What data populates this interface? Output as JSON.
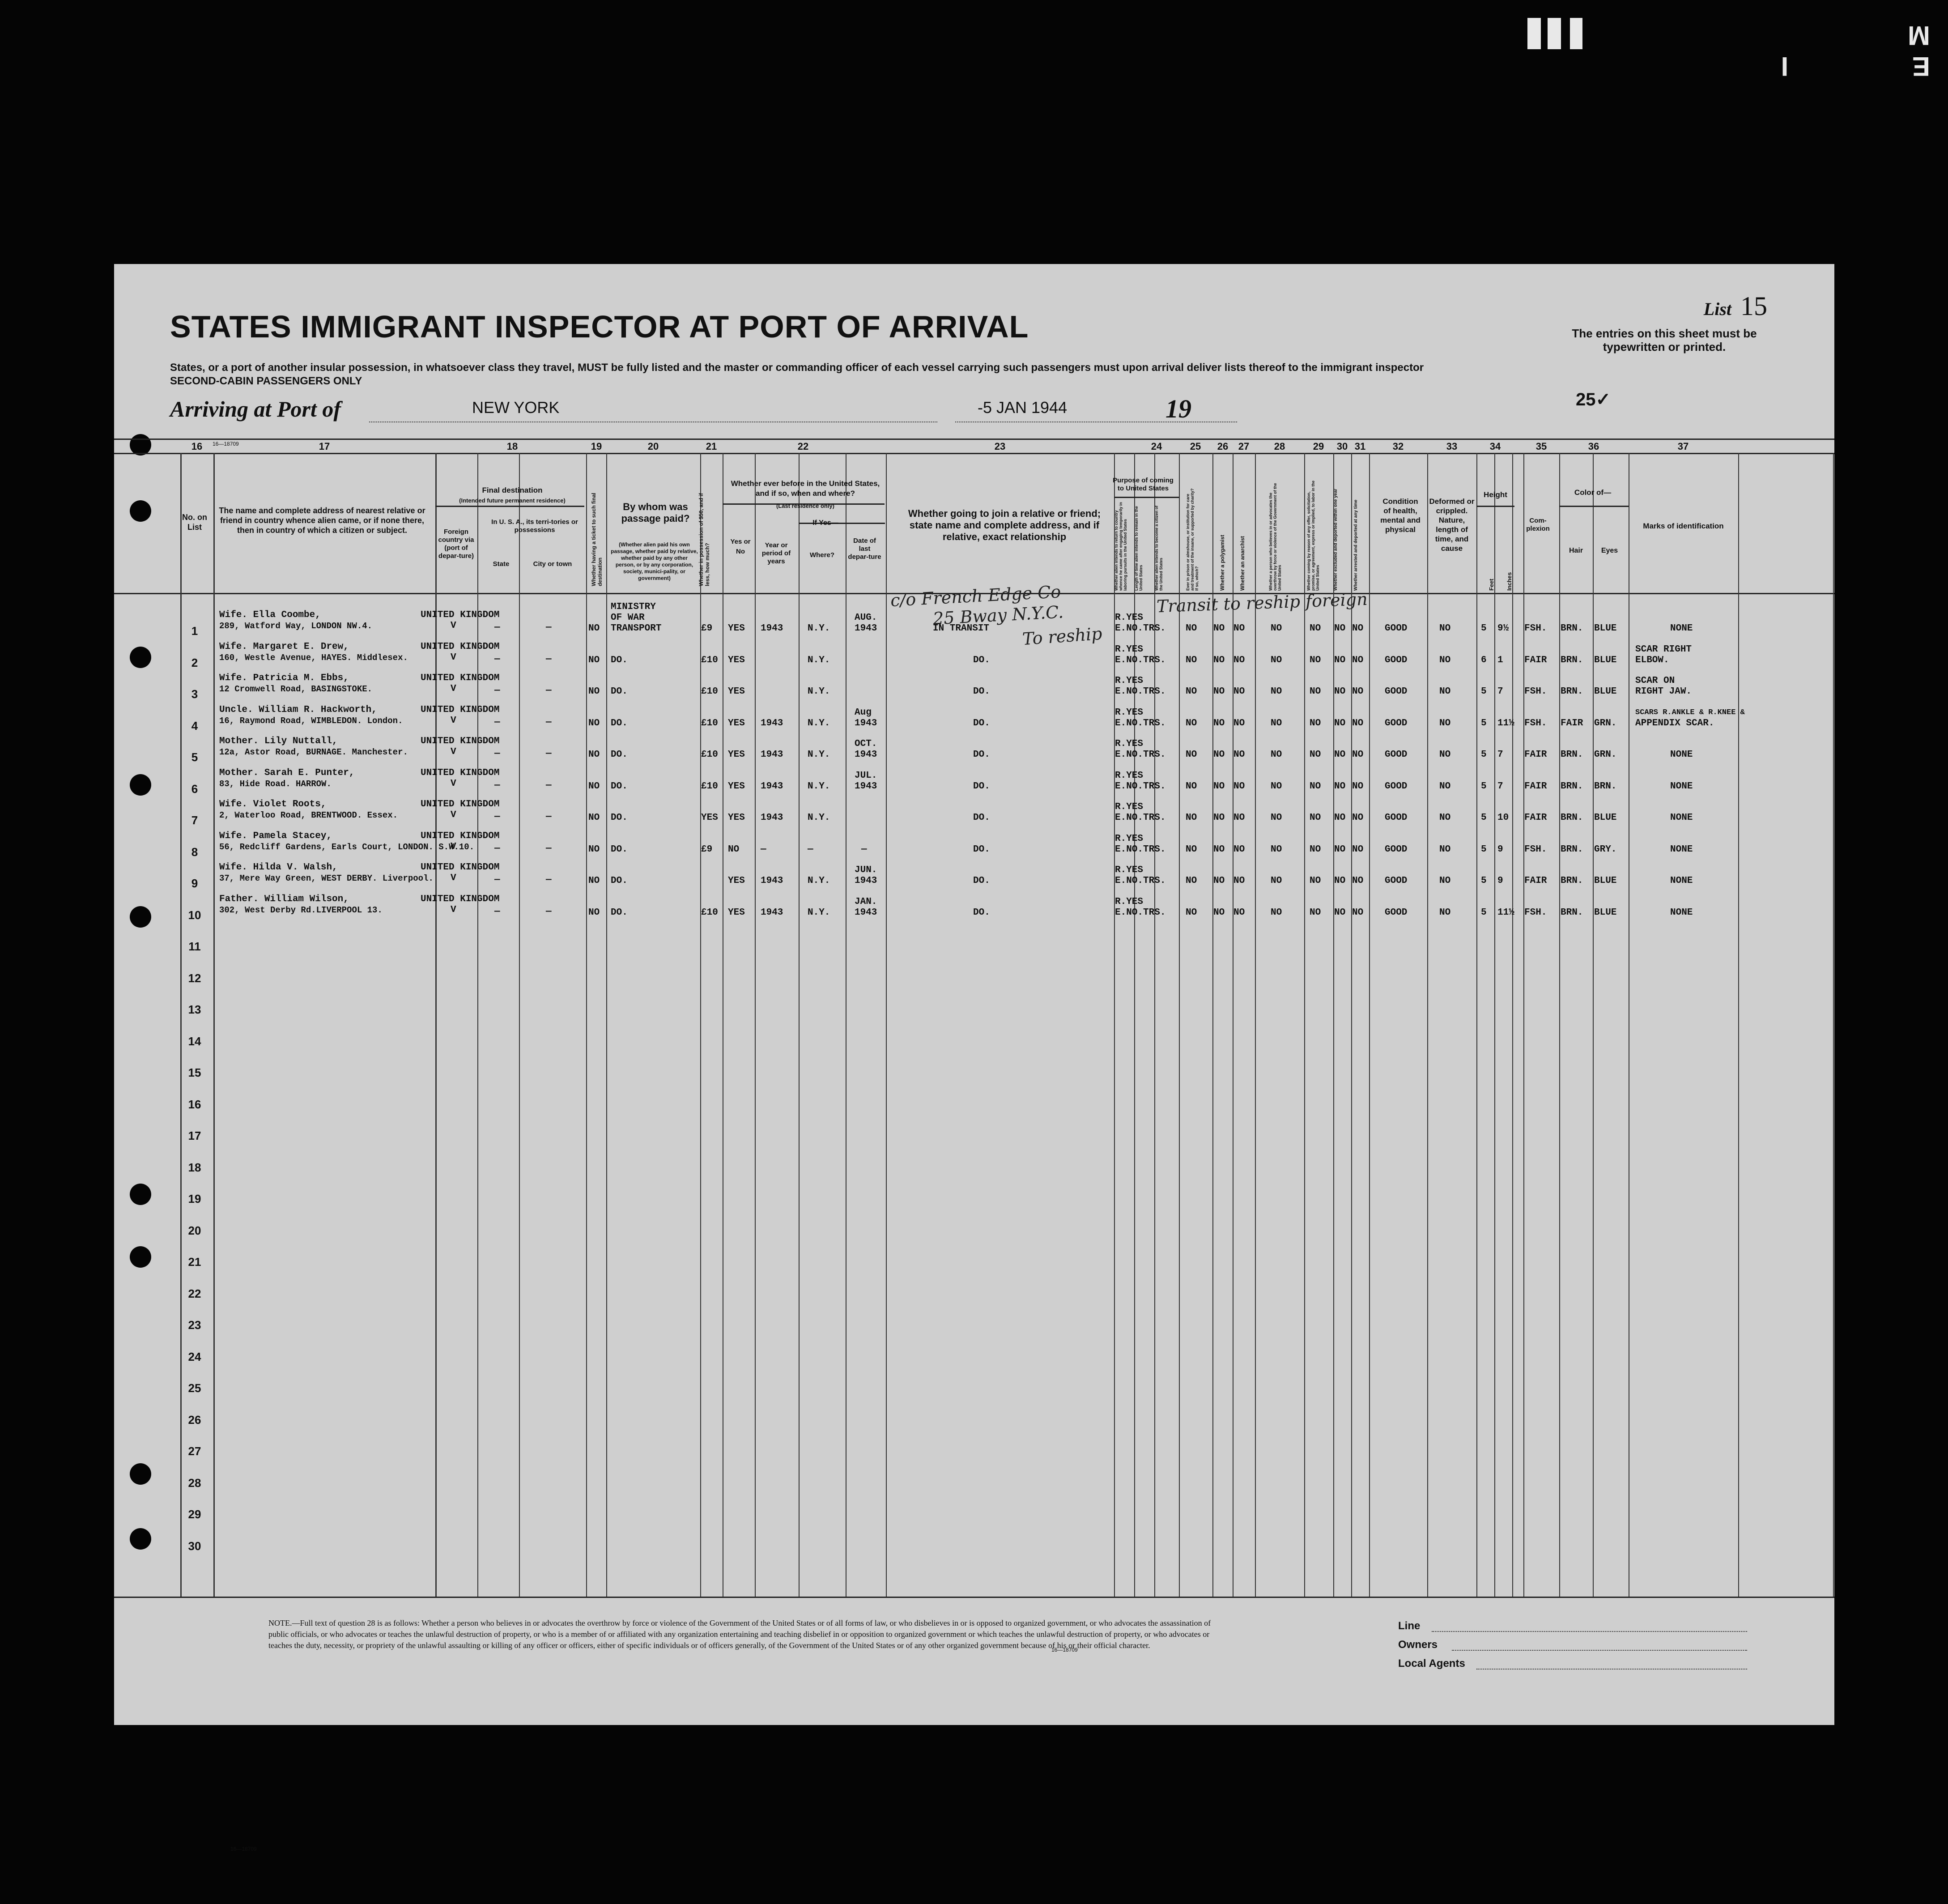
{
  "header": {
    "title": "STATES IMMIGRANT INSPECTOR AT PORT OF ARRIVAL",
    "subtitle": "States, or a port of another insular possession, in whatsoever class they travel, MUST be fully listed and the master or commanding officer of each vessel carrying such passengers must upon arrival deliver lists thereof to the immigrant inspector",
    "subtitle2": "SECOND-CABIN PASSENGERS ONLY",
    "list_label": "List",
    "list_number": "15",
    "entries_note": "The entries on this sheet must be typewritten or printed.",
    "arriving_label": "Arriving at Port of",
    "port": "NEW YORK",
    "date": "-5 JAN 1944",
    "year_label": "19",
    "count": "25✓",
    "film_mark": "E I M"
  },
  "columns": {
    "numbers": [
      "16",
      "17",
      "18",
      "19",
      "20",
      "21",
      "22",
      "23",
      "24",
      "25",
      "26",
      "27",
      "28",
      "29",
      "30",
      "31",
      "32",
      "33",
      "34",
      "35",
      "36",
      "37"
    ],
    "no_on_list": "No. on List",
    "c17": "The name and complete address of nearest relative or friend in country whence alien came, or if none there, then in country of which a citizen or subject.",
    "c18": "Final destination",
    "c18_note": "(Intended future permanent residence)",
    "c18a": "Foreign country via (port of depar-ture)",
    "c18b": "In U. S. A., its terri-tories or possessions",
    "c18_state": "State",
    "c18_city": "City or town",
    "c19": "Whether having a ticket to such final destination",
    "c20": "By whom was passage paid?",
    "c20_note": "(Whether alien paid his own passage, whether paid by relative, whether paid by any other person, or by any corporation, society, munici-pality, or government)",
    "c21": "Whether in possession of $50, and if less, how much?",
    "c22": "Whether ever before in the United States, and if so, when and where?",
    "c22_note": "(Last residence only)",
    "c22_if": "If Yes—",
    "c22_yes": "Yes or No",
    "c22_year": "Year or period of years",
    "c22_where": "Where?",
    "c22_date": "Date of last depar-ture",
    "c23": "Whether going to join a relative or friend; state name and complete address, and if relative, exact relationship",
    "c24": "Purpose of coming to United States",
    "c24a": "Whether alien intends to return to country whence he came after engaging temporarily in laboring pursuits in the United States",
    "c24b": "Length of time alien intends to remain in the United States",
    "c24c": "Whether alien intends to become a citizen of the United States",
    "c25": "Ever in prison or almshouse, or institution for care and treatment of the insane, or supported by charity? If so, which?",
    "c26": "Whether a polygamist",
    "c27": "Whether an anarchist",
    "c28": "Whether a person who believes in or advocates the overthrow by force or violence of the Government of the United States",
    "c29": "Whether coming by reason of any offer, solicitation, promise, or agreement, express or implied, to labor in the United States",
    "c30": "Whether excluded and deported within one year",
    "c31": "Whether arrested and deported at any time",
    "c32": "Condition of health, mental and physical",
    "c33": "Deformed or crippled. Nature, length of time, and cause",
    "c34": "Height",
    "c34_feet": "Feet",
    "c34_inches": "Inches",
    "c35": "Com-plexion",
    "c36": "Color of—",
    "c36_hair": "Hair",
    "c36_eyes": "Eyes",
    "c37": "Marks of identification"
  },
  "rows": [
    {
      "no": "1",
      "rel1": "Wife. Ella Coombe,",
      "rel2": "289, Watford Way, LONDON NW.4.",
      "country": "UNITED KINGDOM",
      "via": "V",
      "state": "—",
      "city": "—",
      "ticket": "NO",
      "paid1": "MINISTRY",
      "paid2": "OF WAR",
      "paid3": "TRANSPORT",
      "money": "£9",
      "yes": "YES",
      "period": "1943",
      "where": "N.Y.",
      "dep1": "AUG.",
      "dep2": "1943",
      "join": "IN TRANSIT",
      "p1": "R.YES",
      "p2": "E.NO.TRS.",
      "c25": "NO",
      "c26": "NO",
      "c27": "NO",
      "c28": "NO",
      "c29": "NO",
      "c30": "NO",
      "c31": "NO",
      "health": "GOOD",
      "deformed": "NO",
      "feet": "5",
      "inches": "9½",
      "complexion": "FSH.",
      "hair": "BRN.",
      "eyes": "BLUE",
      "marks1": "NONE",
      "marks2": ""
    },
    {
      "no": "2",
      "rel1": "Wife. Margaret E. Drew,",
      "rel2": "160, Westle Avenue, HAYES. Middlesex.",
      "country": "UNITED KINGDOM",
      "via": "V",
      "state": "—",
      "city": "—",
      "ticket": "NO",
      "paid1": "DO.",
      "paid2": "",
      "paid3": "",
      "money": "£10",
      "yes": "YES",
      "period": "",
      "where": "N.Y.",
      "dep1": "",
      "dep2": "",
      "join": "DO.",
      "p1": "R.YES",
      "p2": "E.NO.TRS.",
      "c25": "NO",
      "c26": "NO",
      "c27": "NO",
      "c28": "NO",
      "c29": "NO",
      "c30": "NO",
      "c31": "NO",
      "health": "GOOD",
      "deformed": "NO",
      "feet": "6",
      "inches": "1",
      "complexion": "FAIR",
      "hair": "BRN.",
      "eyes": "BLUE",
      "marks1": "SCAR RIGHT",
      "marks2": "ELBOW."
    },
    {
      "no": "3",
      "rel1": "Wife. Patricia M. Ebbs,",
      "rel2": "12 Cromwell Road, BASINGSTOKE.",
      "country": "UNITED KINGDOM",
      "via": "V",
      "state": "—",
      "city": "—",
      "ticket": "NO",
      "paid1": "DO.",
      "paid2": "",
      "paid3": "",
      "money": "£10",
      "yes": "YES",
      "period": "",
      "where": "N.Y.",
      "dep1": "",
      "dep2": "",
      "join": "DO.",
      "p1": "R.YES",
      "p2": "E.NO.TRS.",
      "c25": "NO",
      "c26": "NO",
      "c27": "NO",
      "c28": "NO",
      "c29": "NO",
      "c30": "NO",
      "c31": "NO",
      "health": "GOOD",
      "deformed": "NO",
      "feet": "5",
      "inches": "7",
      "complexion": "FSH.",
      "hair": "BRN.",
      "eyes": "BLUE",
      "marks1": "SCAR ON",
      "marks2": "RIGHT JAW."
    },
    {
      "no": "4",
      "rel1": "Uncle. William R. Hackworth,",
      "rel2": "16, Raymond Road, WIMBLEDON. London.",
      "country": "UNITED KINGDOM",
      "via": "V",
      "state": "—",
      "city": "—",
      "ticket": "NO",
      "paid1": "DO.",
      "paid2": "",
      "paid3": "",
      "money": "£10",
      "yes": "YES",
      "period": "1943",
      "where": "N.Y.",
      "dep1": "Aug",
      "dep2": "1943",
      "join": "DO.",
      "p1": "R.YES",
      "p2": "E.NO.TRS.",
      "c25": "NO",
      "c26": "NO",
      "c27": "NO",
      "c28": "NO",
      "c29": "NO",
      "c30": "NO",
      "c31": "NO",
      "health": "GOOD",
      "deformed": "NO",
      "feet": "5",
      "inches": "11½",
      "complexion": "FSH.",
      "hair": "FAIR",
      "eyes": "GRN.",
      "marks1": "SCARS R.ANKLE & R.KNEE &",
      "marks2": "APPENDIX SCAR."
    },
    {
      "no": "5",
      "rel1": "Mother. Lily Nuttall,",
      "rel2": "12a, Astor Road, BURNAGE. Manchester.",
      "country": "UNITED KINGDOM",
      "via": "V",
      "state": "—",
      "city": "—",
      "ticket": "NO",
      "paid1": "DO.",
      "paid2": "",
      "paid3": "",
      "money": "£10",
      "yes": "YES",
      "period": "1943",
      "where": "N.Y.",
      "dep1": "OCT.",
      "dep2": "1943",
      "join": "DO.",
      "p1": "R.YES",
      "p2": "E.NO.TRS.",
      "c25": "NO",
      "c26": "NO",
      "c27": "NO",
      "c28": "NO",
      "c29": "NO",
      "c30": "NO",
      "c31": "NO",
      "health": "GOOD",
      "deformed": "NO",
      "feet": "5",
      "inches": "7",
      "complexion": "FAIR",
      "hair": "BRN.",
      "eyes": "GRN.",
      "marks1": "NONE",
      "marks2": ""
    },
    {
      "no": "6",
      "rel1": "Mother. Sarah E. Punter,",
      "rel2": "83, Hide Road. HARROW.",
      "country": "UNITED KINGDOM",
      "via": "V",
      "state": "—",
      "city": "—",
      "ticket": "NO",
      "paid1": "DO.",
      "paid2": "",
      "paid3": "",
      "money": "£10",
      "yes": "YES",
      "period": "1943",
      "where": "N.Y.",
      "dep1": "JUL.",
      "dep2": "1943",
      "join": "DO.",
      "p1": "R.YES",
      "p2": "E.NO.TRS.",
      "c25": "NO",
      "c26": "NO",
      "c27": "NO",
      "c28": "NO",
      "c29": "NO",
      "c30": "NO",
      "c31": "NO",
      "health": "GOOD",
      "deformed": "NO",
      "feet": "5",
      "inches": "7",
      "complexion": "FAIR",
      "hair": "BRN.",
      "eyes": "BRN.",
      "marks1": "NONE",
      "marks2": ""
    },
    {
      "no": "7",
      "rel1": "Wife. Violet Roots,",
      "rel2": "2, Waterloo Road, BRENTWOOD. Essex.",
      "country": "UNITED KINGDOM",
      "via": "V",
      "state": "—",
      "city": "—",
      "ticket": "NO",
      "paid1": "DO.",
      "paid2": "",
      "paid3": "",
      "money": "YES",
      "yes": "YES",
      "period": "1943",
      "where": "N.Y.",
      "dep1": "",
      "dep2": "",
      "join": "DO.",
      "p1": "R.YES",
      "p2": "E.NO.TRS.",
      "c25": "NO",
      "c26": "NO",
      "c27": "NO",
      "c28": "NO",
      "c29": "NO",
      "c30": "NO",
      "c31": "NO",
      "health": "GOOD",
      "deformed": "NO",
      "feet": "5",
      "inches": "10",
      "complexion": "FAIR",
      "hair": "BRN.",
      "eyes": "BLUE",
      "marks1": "NONE",
      "marks2": ""
    },
    {
      "no": "8",
      "rel1": "Wife. Pamela Stacey,",
      "rel2": "56, Redcliff Gardens, Earls Court, LONDON. S.W.10.",
      "country": "UNITED KINGDOM",
      "via": "V",
      "state": "—",
      "city": "—",
      "ticket": "NO",
      "paid1": "DO.",
      "paid2": "",
      "paid3": "",
      "money": "£9",
      "yes": "NO",
      "period": "—",
      "where": "—",
      "dep1": "—",
      "dep2": "",
      "join": "DO.",
      "p1": "R.YES",
      "p2": "E.NO.TRS.",
      "c25": "NO",
      "c26": "NO",
      "c27": "NO",
      "c28": "NO",
      "c29": "NO",
      "c30": "NO",
      "c31": "NO",
      "health": "GOOD",
      "deformed": "NO",
      "feet": "5",
      "inches": "9",
      "complexion": "FSH.",
      "hair": "BRN.",
      "eyes": "GRY.",
      "marks1": "NONE",
      "marks2": ""
    },
    {
      "no": "9",
      "rel1": "Wife. Hilda V. Walsh,",
      "rel2": "37, Mere Way Green, WEST DERBY. Liverpool.",
      "country": "UNITED KINGDOM",
      "via": "V",
      "state": "—",
      "city": "—",
      "ticket": "NO",
      "paid1": "DO.",
      "paid2": "",
      "paid3": "",
      "money": "",
      "yes": "YES",
      "period": "1943",
      "where": "N.Y.",
      "dep1": "JUN.",
      "dep2": "1943",
      "join": "DO.",
      "p1": "R.YES",
      "p2": "E.NO.TRS.",
      "c25": "NO",
      "c26": "NO",
      "c27": "NO",
      "c28": "NO",
      "c29": "NO",
      "c30": "NO",
      "c31": "NO",
      "health": "GOOD",
      "deformed": "NO",
      "feet": "5",
      "inches": "9",
      "complexion": "FAIR",
      "hair": "BRN.",
      "eyes": "BLUE",
      "marks1": "NONE",
      "marks2": ""
    },
    {
      "no": "10",
      "rel1": "Father. William Wilson,",
      "rel2": "302, West Derby Rd.LIVERPOOL 13.",
      "country": "UNITED KINGDOM",
      "via": "V",
      "state": "—",
      "city": "—",
      "ticket": "NO",
      "paid1": "DO.",
      "paid2": "",
      "paid3": "",
      "money": "£10",
      "yes": "YES",
      "period": "1943",
      "where": "N.Y.",
      "dep1": "JAN.",
      "dep2": "1943",
      "join": "DO.",
      "p1": "R.YES",
      "p2": "E.NO.TRS.",
      "c25": "NO",
      "c26": "NO",
      "c27": "NO",
      "c28": "NO",
      "c29": "NO",
      "c30": "NO",
      "c31": "NO",
      "health": "GOOD",
      "deformed": "NO",
      "feet": "5",
      "inches": "11½",
      "complexion": "FSH.",
      "hair": "BRN.",
      "eyes": "BLUE",
      "marks1": "NONE",
      "marks2": ""
    }
  ],
  "empty_rows": [
    "11",
    "12",
    "13",
    "14",
    "15",
    "16",
    "17",
    "18",
    "19",
    "20",
    "21",
    "22",
    "23",
    "24",
    "25",
    "26",
    "27",
    "28",
    "29",
    "30"
  ],
  "handwritten": {
    "h1": "c/o French Edge Co",
    "h2": "25 Bway N.Y.C.",
    "h3": "To reship",
    "h4": "Transit to reship foreign",
    "h5": "Aug",
    "h6": "1943"
  },
  "footer": {
    "note": "NOTE.—Full text of question 28 is as follows: Whether a person who believes in or advocates the overthrow by force or violence of the Government of the United States or of all forms of law, or who disbelieves in or is opposed to organized government, or who advocates the assassination of public officials, or who advocates or teaches the unlawful destruction of property, or who is a member of or affiliated with any organization entertaining and teaching disbelief in or opposition to organized government or which teaches the unlawful destruction of property, or who advocates or teaches the duty, necessity, or propriety of the unlawful assaulting or killing of any officer or officers, either of specific individuals or of officers generally, of the Government of the United States or of any other organized government because of his or their official character.",
    "line_label": "Line",
    "owners_label": "Owners",
    "agents_label": "Local Agents",
    "code": "16—18709"
  }
}
